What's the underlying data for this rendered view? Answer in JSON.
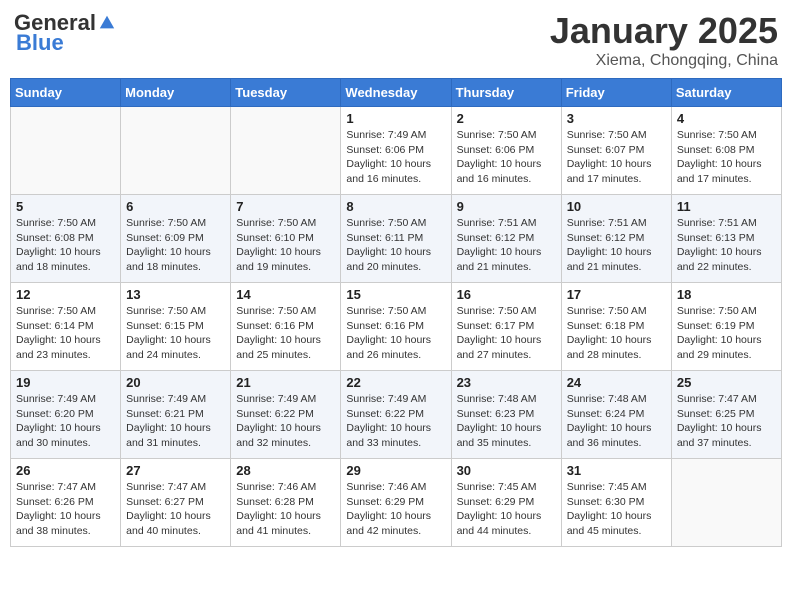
{
  "logo": {
    "general": "General",
    "blue": "Blue"
  },
  "header": {
    "title": "January 2025",
    "subtitle": "Xiema, Chongqing, China"
  },
  "weekdays": [
    "Sunday",
    "Monday",
    "Tuesday",
    "Wednesday",
    "Thursday",
    "Friday",
    "Saturday"
  ],
  "weeks": [
    [
      {
        "day": "",
        "info": ""
      },
      {
        "day": "",
        "info": ""
      },
      {
        "day": "",
        "info": ""
      },
      {
        "day": "1",
        "info": "Sunrise: 7:49 AM\nSunset: 6:06 PM\nDaylight: 10 hours\nand 16 minutes."
      },
      {
        "day": "2",
        "info": "Sunrise: 7:50 AM\nSunset: 6:06 PM\nDaylight: 10 hours\nand 16 minutes."
      },
      {
        "day": "3",
        "info": "Sunrise: 7:50 AM\nSunset: 6:07 PM\nDaylight: 10 hours\nand 17 minutes."
      },
      {
        "day": "4",
        "info": "Sunrise: 7:50 AM\nSunset: 6:08 PM\nDaylight: 10 hours\nand 17 minutes."
      }
    ],
    [
      {
        "day": "5",
        "info": "Sunrise: 7:50 AM\nSunset: 6:08 PM\nDaylight: 10 hours\nand 18 minutes."
      },
      {
        "day": "6",
        "info": "Sunrise: 7:50 AM\nSunset: 6:09 PM\nDaylight: 10 hours\nand 18 minutes."
      },
      {
        "day": "7",
        "info": "Sunrise: 7:50 AM\nSunset: 6:10 PM\nDaylight: 10 hours\nand 19 minutes."
      },
      {
        "day": "8",
        "info": "Sunrise: 7:50 AM\nSunset: 6:11 PM\nDaylight: 10 hours\nand 20 minutes."
      },
      {
        "day": "9",
        "info": "Sunrise: 7:51 AM\nSunset: 6:12 PM\nDaylight: 10 hours\nand 21 minutes."
      },
      {
        "day": "10",
        "info": "Sunrise: 7:51 AM\nSunset: 6:12 PM\nDaylight: 10 hours\nand 21 minutes."
      },
      {
        "day": "11",
        "info": "Sunrise: 7:51 AM\nSunset: 6:13 PM\nDaylight: 10 hours\nand 22 minutes."
      }
    ],
    [
      {
        "day": "12",
        "info": "Sunrise: 7:50 AM\nSunset: 6:14 PM\nDaylight: 10 hours\nand 23 minutes."
      },
      {
        "day": "13",
        "info": "Sunrise: 7:50 AM\nSunset: 6:15 PM\nDaylight: 10 hours\nand 24 minutes."
      },
      {
        "day": "14",
        "info": "Sunrise: 7:50 AM\nSunset: 6:16 PM\nDaylight: 10 hours\nand 25 minutes."
      },
      {
        "day": "15",
        "info": "Sunrise: 7:50 AM\nSunset: 6:16 PM\nDaylight: 10 hours\nand 26 minutes."
      },
      {
        "day": "16",
        "info": "Sunrise: 7:50 AM\nSunset: 6:17 PM\nDaylight: 10 hours\nand 27 minutes."
      },
      {
        "day": "17",
        "info": "Sunrise: 7:50 AM\nSunset: 6:18 PM\nDaylight: 10 hours\nand 28 minutes."
      },
      {
        "day": "18",
        "info": "Sunrise: 7:50 AM\nSunset: 6:19 PM\nDaylight: 10 hours\nand 29 minutes."
      }
    ],
    [
      {
        "day": "19",
        "info": "Sunrise: 7:49 AM\nSunset: 6:20 PM\nDaylight: 10 hours\nand 30 minutes."
      },
      {
        "day": "20",
        "info": "Sunrise: 7:49 AM\nSunset: 6:21 PM\nDaylight: 10 hours\nand 31 minutes."
      },
      {
        "day": "21",
        "info": "Sunrise: 7:49 AM\nSunset: 6:22 PM\nDaylight: 10 hours\nand 32 minutes."
      },
      {
        "day": "22",
        "info": "Sunrise: 7:49 AM\nSunset: 6:22 PM\nDaylight: 10 hours\nand 33 minutes."
      },
      {
        "day": "23",
        "info": "Sunrise: 7:48 AM\nSunset: 6:23 PM\nDaylight: 10 hours\nand 35 minutes."
      },
      {
        "day": "24",
        "info": "Sunrise: 7:48 AM\nSunset: 6:24 PM\nDaylight: 10 hours\nand 36 minutes."
      },
      {
        "day": "25",
        "info": "Sunrise: 7:47 AM\nSunset: 6:25 PM\nDaylight: 10 hours\nand 37 minutes."
      }
    ],
    [
      {
        "day": "26",
        "info": "Sunrise: 7:47 AM\nSunset: 6:26 PM\nDaylight: 10 hours\nand 38 minutes."
      },
      {
        "day": "27",
        "info": "Sunrise: 7:47 AM\nSunset: 6:27 PM\nDaylight: 10 hours\nand 40 minutes."
      },
      {
        "day": "28",
        "info": "Sunrise: 7:46 AM\nSunset: 6:28 PM\nDaylight: 10 hours\nand 41 minutes."
      },
      {
        "day": "29",
        "info": "Sunrise: 7:46 AM\nSunset: 6:29 PM\nDaylight: 10 hours\nand 42 minutes."
      },
      {
        "day": "30",
        "info": "Sunrise: 7:45 AM\nSunset: 6:29 PM\nDaylight: 10 hours\nand 44 minutes."
      },
      {
        "day": "31",
        "info": "Sunrise: 7:45 AM\nSunset: 6:30 PM\nDaylight: 10 hours\nand 45 minutes."
      },
      {
        "day": "",
        "info": ""
      }
    ]
  ]
}
